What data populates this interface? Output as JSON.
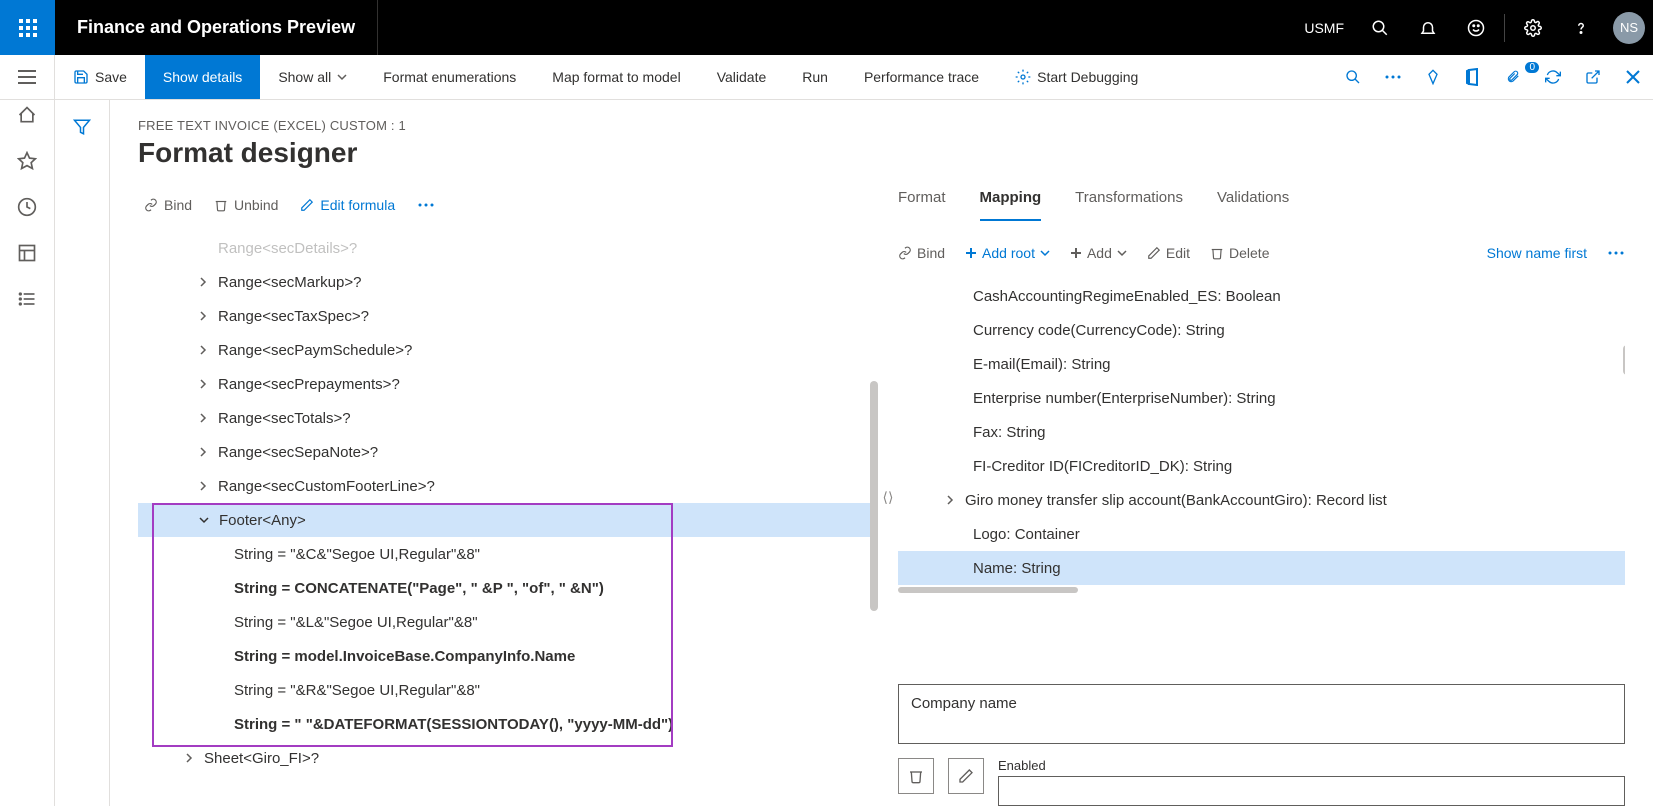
{
  "header": {
    "app_title": "Finance and Operations Preview",
    "company": "USMF",
    "user_initials": "NS"
  },
  "cmdbar": {
    "save": "Save",
    "show_details": "Show details",
    "show_all": "Show all",
    "format_enum": "Format enumerations",
    "map_format": "Map format to model",
    "validate": "Validate",
    "run": "Run",
    "perf_trace": "Performance trace",
    "start_debug": "Start Debugging"
  },
  "page": {
    "breadcrumb": "FREE TEXT INVOICE (EXCEL) CUSTOM : 1",
    "title": "Format designer"
  },
  "left_cmd": {
    "bind": "Bind",
    "unbind": "Unbind",
    "edit_formula": "Edit formula"
  },
  "tree": {
    "r0": "Range<secDetails>?",
    "r1": "Range<secMarkup>?",
    "r2": "Range<secTaxSpec>?",
    "r3": "Range<secPaymSchedule>?",
    "r4": "Range<secPrepayments>?",
    "r5": "Range<secTotals>?",
    "r6": "Range<secSepaNote>?",
    "r7": "Range<secCustomFooterLine>?",
    "footer": "Footer<Any>",
    "s1": "String = \"&C&\"Segoe UI,Regular\"&8\"",
    "s2": "String = CONCATENATE(\"Page\", \" &P \", \"of\", \" &N\")",
    "s3": "String = \"&L&\"Segoe UI,Regular\"&8\"",
    "s4": "String = model.InvoiceBase.CompanyInfo.Name",
    "s5": "String = \"&R&\"Segoe UI,Regular\"&8\"",
    "s6": "String = \" \"&DATEFORMAT(SESSIONTODAY(), \"yyyy-MM-dd\")",
    "sheet": "Sheet<Giro_FI>?"
  },
  "tabs": {
    "format": "Format",
    "mapping": "Mapping",
    "transformations": "Transformations",
    "validations": "Validations"
  },
  "right_cmd": {
    "bind": "Bind",
    "add_root": "Add root",
    "add": "Add",
    "edit": "Edit",
    "delete": "Delete",
    "show_name_first": "Show name first"
  },
  "ds": {
    "i0": "CashAccountingRegimeEnabled_ES: Boolean",
    "i1": "Currency code(CurrencyCode): String",
    "i2": "E-mail(Email): String",
    "i3": "Enterprise number(EnterpriseNumber): String",
    "i4": "Fax: String",
    "i5": "FI-Creditor ID(FICreditorID_DK): String",
    "i6": "Giro money transfer slip account(BankAccountGiro): Record list",
    "i7": "Logo: Container",
    "i8": "Name: String"
  },
  "info": {
    "company_name": "Company name",
    "enabled": "Enabled"
  },
  "badge_count": "0"
}
